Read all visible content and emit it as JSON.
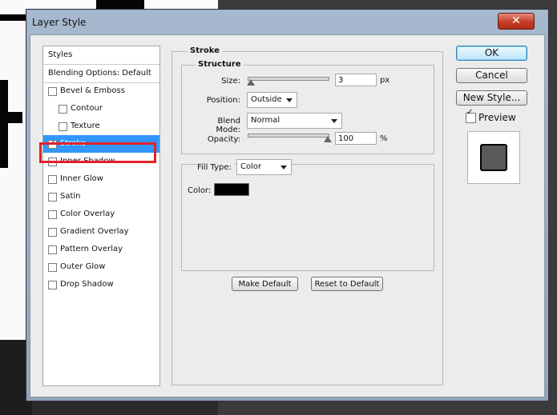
{
  "window": {
    "title": "Layer Style",
    "close_label": "✕"
  },
  "styles_panel": {
    "header": "Styles",
    "blending": "Blending Options: Default",
    "items": [
      {
        "label": "Bevel & Emboss",
        "checked": false,
        "indent": false,
        "selected": false
      },
      {
        "label": "Contour",
        "checked": false,
        "indent": true,
        "selected": false
      },
      {
        "label": "Texture",
        "checked": false,
        "indent": true,
        "selected": false
      },
      {
        "label": "Stroke",
        "checked": true,
        "indent": false,
        "selected": true
      },
      {
        "label": "Inner Shadow",
        "checked": false,
        "indent": false,
        "selected": false
      },
      {
        "label": "Inner Glow",
        "checked": false,
        "indent": false,
        "selected": false
      },
      {
        "label": "Satin",
        "checked": false,
        "indent": false,
        "selected": false
      },
      {
        "label": "Color Overlay",
        "checked": false,
        "indent": false,
        "selected": false
      },
      {
        "label": "Gradient Overlay",
        "checked": false,
        "indent": false,
        "selected": false
      },
      {
        "label": "Pattern Overlay",
        "checked": false,
        "indent": false,
        "selected": false
      },
      {
        "label": "Outer Glow",
        "checked": false,
        "indent": false,
        "selected": false
      },
      {
        "label": "Drop Shadow",
        "checked": false,
        "indent": false,
        "selected": false
      }
    ]
  },
  "stroke": {
    "section_title": "Stroke",
    "structure_title": "Structure",
    "size_label": "Size:",
    "size_value": "3",
    "size_unit": "px",
    "position_label": "Position:",
    "position_value": "Outside",
    "blend_label": "Blend Mode:",
    "blend_value": "Normal",
    "opacity_label": "Opacity:",
    "opacity_value": "100",
    "opacity_unit": "%",
    "fill_type_label": "Fill Type:",
    "fill_type_value": "Color",
    "color_label": "Color:",
    "make_default": "Make Default",
    "reset_default": "Reset to Default"
  },
  "buttons": {
    "ok": "OK",
    "cancel": "Cancel",
    "new_style": "New Style...",
    "preview_label": "Preview",
    "preview_checked": true
  },
  "colors": {
    "selection": "#3297fd",
    "highlight_outline": "#e1222b",
    "stroke_color": "#000000"
  }
}
